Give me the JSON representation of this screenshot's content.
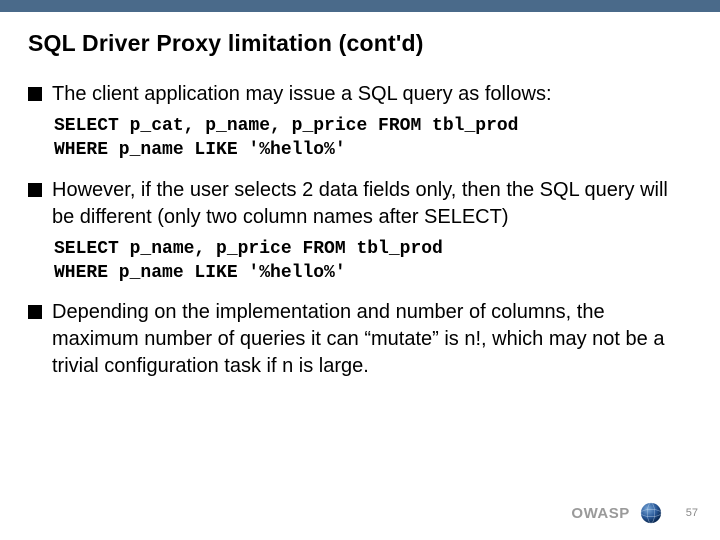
{
  "title": "SQL Driver Proxy limitation (cont'd)",
  "bullets": [
    {
      "text": "The client application may issue a SQL query as follows:",
      "code": "SELECT p_cat, p_name, p_price FROM tbl_prod\nWHERE p_name LIKE '%hello%'"
    },
    {
      "text": "However, if the user selects 2 data fields only, then the SQL query will be different (only two column names after SELECT)",
      "code": "SELECT p_name, p_price FROM tbl_prod\nWHERE p_name LIKE '%hello%'"
    },
    {
      "text": "Depending on the implementation and number of columns, the maximum number of queries it can “mutate” is n!, which may not be a trivial configuration task if n is large.",
      "code": ""
    }
  ],
  "footer": {
    "brand": "OWASP",
    "page": "57"
  }
}
